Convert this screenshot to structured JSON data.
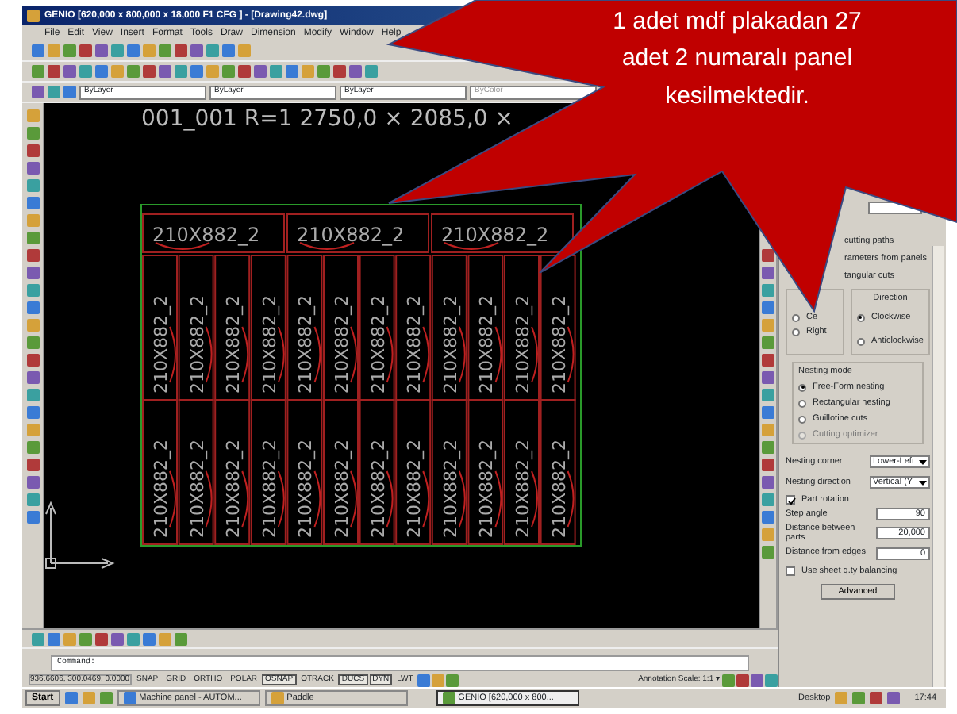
{
  "window": {
    "title": "GENIO [620,000 x 800,000 x 18,000 F1 CFG ] - [Drawing42.dwg]"
  },
  "menu": [
    "File",
    "Edit",
    "View",
    "Insert",
    "Format",
    "Tools",
    "Draw",
    "Dimension",
    "Modify",
    "Window",
    "Help"
  ],
  "layer_bar": {
    "layer": "ByLayer",
    "linetype": "ByLayer",
    "lineweight": "ByLayer",
    "color_control": "ByColor"
  },
  "canvas": {
    "header": "001_001 R=1 2750,0 × 2085,0 ×",
    "top_parts": [
      "210X882_2",
      "210X882_2",
      "210X882_2"
    ],
    "grid_parts": [
      "210X882_2",
      "210X882_2",
      "210X882_2",
      "210X882_2",
      "210X882_2",
      "210X882_2",
      "210X882_2",
      "210X882_2",
      "210X882_2",
      "210X882_2",
      "210X882_2",
      "210X882_2",
      "210X882_2",
      "210X882_2",
      "210X882_2",
      "210X882_2",
      "210X882_2",
      "210X882_2",
      "210X882_2",
      "210X882_2",
      "210X882_2",
      "210X882_2",
      "210X882_2",
      "210X882_2"
    ]
  },
  "options_panel": {
    "lines": [
      "cutting paths",
      "rameters from panels",
      "tangular cuts"
    ],
    "start_group": {
      "items": [
        {
          "label": "Ce",
          "selected": false
        },
        {
          "label": "Right",
          "selected": false
        }
      ]
    },
    "direction": {
      "title": "Direction",
      "items": [
        {
          "label": "Clockwise",
          "selected": true
        },
        {
          "label": "Anticlockwise",
          "selected": false
        }
      ]
    },
    "nesting_mode": {
      "title": "Nesting mode",
      "items": [
        {
          "label": "Free-Form nesting",
          "selected": true,
          "disabled": false
        },
        {
          "label": "Rectangular nesting",
          "selected": false,
          "disabled": false
        },
        {
          "label": "Guillotine cuts",
          "selected": false,
          "disabled": false
        },
        {
          "label": "Cutting optimizer",
          "selected": false,
          "disabled": true
        }
      ]
    },
    "selects": [
      {
        "label": "Nesting corner",
        "value": "Lower-Left"
      },
      {
        "label": "Nesting direction",
        "value": "Vertical (Y"
      }
    ],
    "part_rotation": {
      "label": "Part rotation",
      "checked": true
    },
    "fields": [
      {
        "label": "Step angle",
        "value": "90"
      },
      {
        "label": "Distance between parts",
        "value": "20,000"
      },
      {
        "label": "Distance from edges",
        "value": "0"
      }
    ],
    "sheet_balancing": {
      "label": "Use sheet q.ty balancing",
      "checked": false
    },
    "advanced_button": "Advanced"
  },
  "command_line": {
    "prompt": "Command:"
  },
  "status_bar": {
    "coords": "936.6606, 300.0469, 0.0000",
    "toggles": [
      {
        "label": "SNAP",
        "on": false
      },
      {
        "label": "GRID",
        "on": false
      },
      {
        "label": "ORTHO",
        "on": false
      },
      {
        "label": "POLAR",
        "on": false
      },
      {
        "label": "OSNAP",
        "on": true
      },
      {
        "label": "OTRACK",
        "on": false
      },
      {
        "label": "DUCS",
        "on": true
      },
      {
        "label": "DYN",
        "on": true
      },
      {
        "label": "LWT",
        "on": false
      }
    ],
    "annotation_scale": "Annotation Scale: 1:1 ▾"
  },
  "taskbar": {
    "start": "Start",
    "tasks": [
      {
        "label": "Machine panel - AUTOM...",
        "selected": false
      },
      {
        "label": "Paddle",
        "selected": false
      },
      {
        "label": "GENIO [620,000 x 800...",
        "selected": true
      }
    ],
    "desktop": "Desktop",
    "clock": "17:44"
  },
  "callout": {
    "text": "1 adet mdf plakadan 27 adet 2 numaralı panel kesilmektedir."
  }
}
